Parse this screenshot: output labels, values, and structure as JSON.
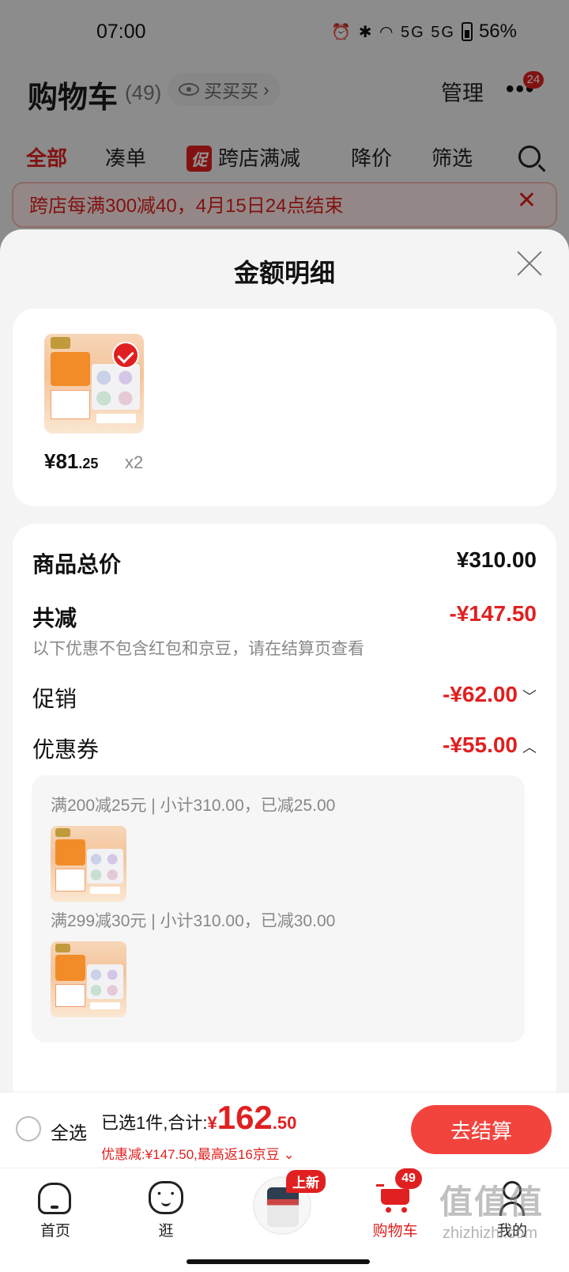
{
  "status_bar": {
    "time": "07:00",
    "icons": "⏰ ✱ ◠ 5G 5G",
    "battery": "56%"
  },
  "header": {
    "title": "购物车",
    "count": "(49)",
    "buy_pill": "买买买",
    "buy_pill_chevron": "›",
    "manage": "管理",
    "more_dots": "•••",
    "more_badge": "24"
  },
  "tabs": [
    {
      "label": "全部",
      "active": true
    },
    {
      "label": "凑单"
    },
    {
      "label": "跨店满减",
      "tag": "促"
    },
    {
      "label": "降价"
    },
    {
      "label": "筛选"
    }
  ],
  "promo_banner": {
    "text": "跨店每满300减40，4月15日24点结束",
    "close": "✕"
  },
  "sheet": {
    "title": "金额明细",
    "products": [
      {
        "price_int": "¥81",
        "price_dec": ".25",
        "qty": "x2"
      }
    ],
    "total_label": "商品总价",
    "total_value": "¥310.00",
    "discount_label": "共减",
    "discount_value": "-¥147.50",
    "discount_note": "以下优惠不包含红包和京豆，请在结算页查看",
    "promo_label": "促销",
    "promo_value": "-¥62.00",
    "promo_chevron": "﹀",
    "coupon_label": "优惠券",
    "coupon_value": "-¥55.00",
    "coupon_chevron": "︿",
    "coupon_lines": [
      "满200减25元 | 小计310.00，已减25.00",
      "满299减30元 | 小计310.00，已减30.00"
    ]
  },
  "checkout": {
    "select_all": "全选",
    "selected_prefix": "已选1件,合计:",
    "currency": "¥",
    "total_int": "162",
    "total_dec": ".50",
    "discount_line": "优惠减:¥147.50,最高返16京豆 ⌄",
    "button": "去结算"
  },
  "bottom_nav": {
    "home": "首页",
    "browse": "逛",
    "new_badge": "上新",
    "cart": "购物车",
    "cart_badge": "49",
    "me": "我的"
  },
  "watermark": {
    "text": "值值值",
    "url": "zhizhizhi.com"
  },
  "colors": {
    "accent": "#e02020",
    "checkout_button": "#f2443d",
    "overlay": "rgba(0,0,0,0.42)"
  }
}
